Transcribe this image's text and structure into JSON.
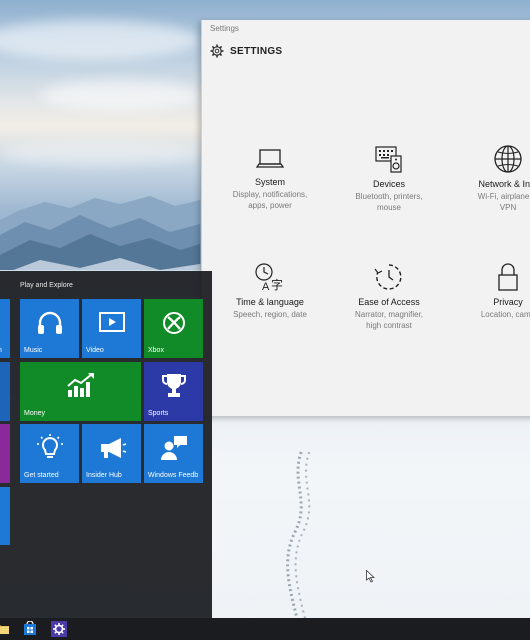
{
  "window": {
    "title": "Settings",
    "header": "SETTINGS"
  },
  "settings_tiles": [
    {
      "icon": "laptop-icon",
      "name": "System",
      "desc1": "Display, notifications,",
      "desc2": "apps, power",
      "desc3": ""
    },
    {
      "icon": "keyboard-speaker-icon",
      "name": "Devices",
      "desc1": "Bluetooth, printers,",
      "desc2": "mouse",
      "desc3": ""
    },
    {
      "icon": "globe-icon",
      "name": "Network & Inte",
      "desc1": "Wi-Fi, airplane m",
      "desc2": "VPN",
      "desc3": ""
    },
    {
      "icon": "time-language-icon",
      "name": "Time & language",
      "desc1": "Speech, region, date",
      "desc2": "",
      "desc3": ""
    },
    {
      "icon": "ease-of-access-icon",
      "name": "Ease of Access",
      "desc1": "Narrator, magnifier,",
      "desc2": "high contrast",
      "desc3": ""
    },
    {
      "icon": "lock-icon",
      "name": "Privacy",
      "desc1": "Location, came",
      "desc2": "",
      "desc3": ""
    }
  ],
  "start_menu": {
    "group_label": "Play and Explore",
    "tiles": {
      "partial_top": "m",
      "music": "Music",
      "video": "Video",
      "xbox": "Xbox",
      "money": "Money",
      "sports": "Sports",
      "get_started": "Get started",
      "insider_hub": "Insider Hub",
      "windows_feedback": "Windows Feedb"
    }
  },
  "colors": {
    "tile_blue": "#1e78d6",
    "tile_green": "#118a28",
    "tile_navy": "#2b3aa6",
    "tile_purple": "#8a2a9a",
    "settings_bg": "#f2f2f2"
  },
  "taskbar": {
    "icons": [
      "file-explorer-icon",
      "store-icon",
      "settings-gear-icon"
    ]
  }
}
